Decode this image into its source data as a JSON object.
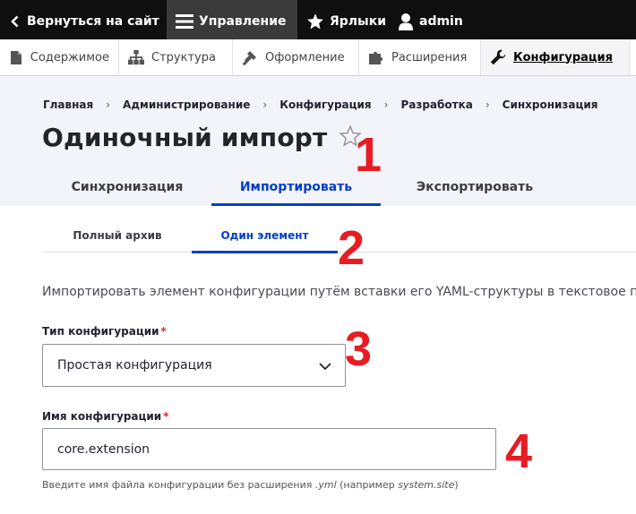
{
  "toolbar": {
    "back": "Вернуться на сайт",
    "manage": "Управление",
    "shortcuts": "Ярлыки",
    "user": "admin"
  },
  "tray": [
    {
      "label": "Содержимое",
      "icon": "page-icon"
    },
    {
      "label": "Структура",
      "icon": "sitemap-icon"
    },
    {
      "label": "Оформление",
      "icon": "brush-icon"
    },
    {
      "label": "Расширения",
      "icon": "puzzle-icon"
    },
    {
      "label": "Конфигурация",
      "icon": "wrench-icon",
      "active": true
    }
  ],
  "breadcrumb": [
    "Главная",
    "Администрирование",
    "Конфигурация",
    "Разработка",
    "Синхронизация"
  ],
  "page": {
    "title": "Одиночный импорт"
  },
  "primary_tabs": [
    {
      "label": "Синхронизация"
    },
    {
      "label": "Импортировать",
      "active": true
    },
    {
      "label": "Экспортировать"
    }
  ],
  "secondary_tabs": [
    {
      "label": "Полный архив"
    },
    {
      "label": "Один элемент",
      "active": true
    }
  ],
  "form": {
    "description": "Импортировать элемент конфигурации путём вставки его YAML-структуры в текстовое по",
    "config_type_label": "Тип конфигурации",
    "config_type_value": "Простая конфигурация",
    "config_name_label": "Имя конфигурации",
    "config_name_value": "core.extension",
    "help_prefix": "Введите имя файла конфигурации без расширения ",
    "help_ext": ".yml",
    "help_mid": " (например ",
    "help_example": "system.site",
    "help_suffix": ")",
    "required_mark": "*"
  },
  "annotations": [
    "1",
    "2",
    "3",
    "4"
  ],
  "colors": {
    "accent": "#003ecc",
    "toolbar": "#0f0f0f",
    "annotation": "#e81b23",
    "required": "#dc2323"
  }
}
